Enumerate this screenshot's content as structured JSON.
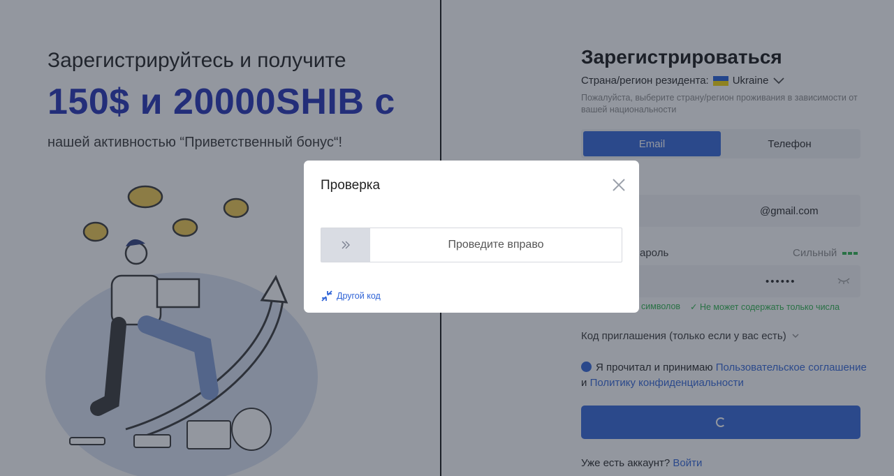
{
  "promo": {
    "line1": "Зарегистрируйтесь и получите",
    "amount": "150$ и 20000SHIB с",
    "line3": "нашей активностью “Приветственный бонус“!"
  },
  "register": {
    "title": "Зарегистрироваться",
    "country_label": "Страна/регион резидента:",
    "country_value": "Ukraine",
    "country_hint": "Пожалуйста, выберите страну/регион проживания в зависимости от вашей национальности",
    "tabs": [
      {
        "label": "Email",
        "active": true
      },
      {
        "label": "Телефон",
        "active": false
      }
    ],
    "email_value": "@gmail.com",
    "password_label": "ароль",
    "password_strength": "Сильный",
    "password_value": "••••••",
    "rules": [
      "символов",
      "Не может содержать только числа"
    ],
    "invite_label": "Код приглашения (только если у вас есть)",
    "agree_text": "Я прочитал и принимаю",
    "agree_link1": "Пользовательское соглашение",
    "agree_and": "и",
    "agree_link2": "Политику конфиденциальности",
    "login_prompt": "Уже есть аккаунт?",
    "login_link": "Войти"
  },
  "modal": {
    "title": "Проверка",
    "slider_text": "Проведите вправо",
    "other_code": "Другой код"
  },
  "colors": {
    "accent": "#2f63d6",
    "promo_blue": "#1f2db3",
    "success": "#2bb34a",
    "overlay": "rgba(40,48,64,0.5)"
  }
}
